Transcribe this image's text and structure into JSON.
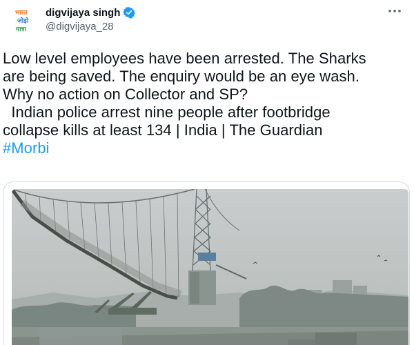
{
  "author": {
    "display_name": "digvijaya singh",
    "handle": "@digvijaya_28",
    "avatar_text": [
      "भारत",
      "जोड़ो",
      "यात्रा"
    ],
    "avatar_icon": "bharat-jodo-yatra-logo"
  },
  "header": {
    "more_icon": "more-horizontal-icon",
    "verified_icon": "verified-badge-icon"
  },
  "tweet": {
    "lines": [
      "Low level employees have been arrested. The Sharks",
      "are being saved. The enquiry would be an eye wash.",
      "Why no action on Collector and SP?",
      "  Indian police arrest nine people after footbridge",
      "collapse kills at least 134 | India | The Guardian"
    ],
    "hashtag": "#Morbi"
  },
  "media": {
    "subject": "photo-collapsed-suspension-bridge"
  },
  "colors": {
    "accent": "#1d9bf0",
    "text": "#0f1419",
    "secondary": "#536471",
    "border": "#cfd9de"
  }
}
